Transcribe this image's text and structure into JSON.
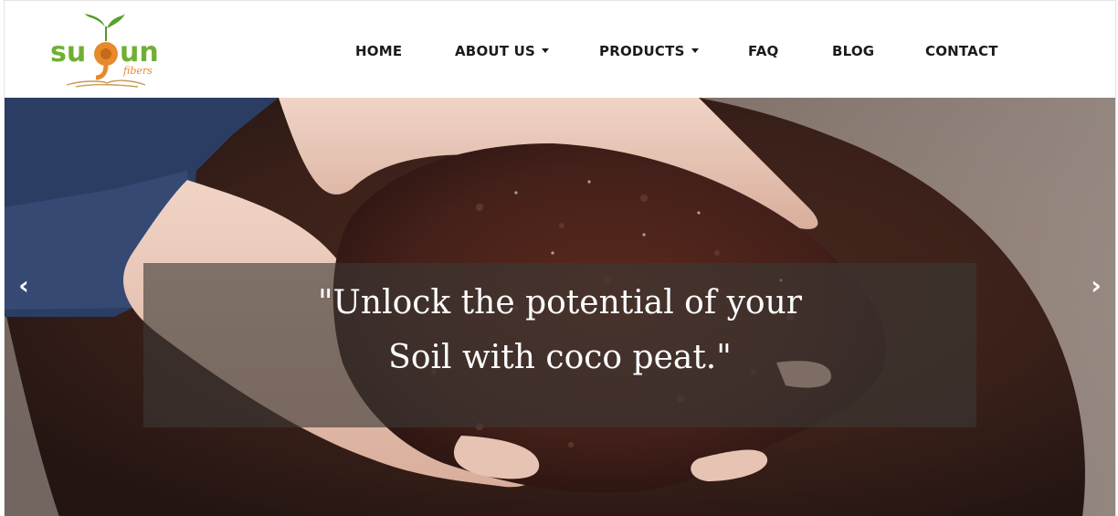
{
  "brand": {
    "logo_text": "sugun",
    "logo_sub": "fibers",
    "colors": {
      "green": "#5aa028",
      "orange": "#e8892a",
      "leaf": "#4f9a2a"
    }
  },
  "nav": {
    "home": "HOME",
    "about": "ABOUT US",
    "products": "PRODUCTS",
    "faq": "FAQ",
    "blog": "BLOG",
    "contact": "CONTACT"
  },
  "carousel": {
    "caption_line1": "\"Unlock the potential of your",
    "caption_line2": "Soil with coco peat.\"",
    "prev_icon": "‹",
    "next_icon": "›"
  }
}
